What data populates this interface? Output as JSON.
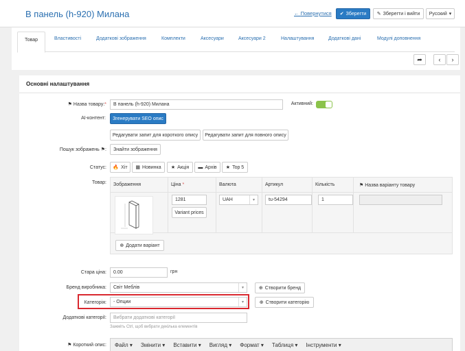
{
  "header": {
    "title": "В панель (h-920) Милана",
    "back_label": "Повернутися",
    "save_label": "Зберегти",
    "save_exit_label": "Зберегти і вийти",
    "language": "Русский"
  },
  "tabs": [
    {
      "label": "Товар",
      "active": true
    },
    {
      "label": "Властивості",
      "active": false
    },
    {
      "label": "Додаткові зображення",
      "active": false
    },
    {
      "label": "Комплекти",
      "active": false
    },
    {
      "label": "Аксесуари",
      "active": false
    },
    {
      "label": "Аксесуари 2",
      "active": false
    },
    {
      "label": "Налаштування",
      "active": false
    },
    {
      "label": "Додаткові дані",
      "active": false
    },
    {
      "label": "Модулі доповнення",
      "active": false
    }
  ],
  "section_title": "Основні налаштування",
  "form": {
    "name_label": "Назва товару:",
    "name_value": "В панель (h-920) Милана",
    "active_label": "Активний:",
    "active": true,
    "ai_label": "AI-контент:",
    "seo_button": "Згенерувати SEO опис",
    "edit_short_prompt": "Редагувати запит для короткого опису",
    "edit_full_prompt": "Редагувати запит для повного опису",
    "image_search_label": "Пошук зображень",
    "find_images_button": "Знайти зображення",
    "status_label": "Статус:",
    "status_buttons": [
      "Хіт",
      "Новинка",
      "Акція",
      "Архів",
      "Top 5"
    ],
    "product_label": "Товар:",
    "old_price_label": "Стара ціна:",
    "old_price_value": "0.00",
    "currency_suffix": "грн",
    "brand_label": "Бренд виробника:",
    "brand_value": "Світ Меблів",
    "create_brand_button": "Створити бренд",
    "category_label": "Категорія:",
    "category_value": "- Опции",
    "create_category_button": "Створити категорію",
    "extra_categories_label": "Додаткові категорії:",
    "extra_categories_placeholder": "Вибрати додаткові категорії",
    "extra_categories_hint": "Зажміть Ctrl, щоб вибрати декілька елементів",
    "short_desc_label": "Короткий опис:"
  },
  "variants": {
    "headers": [
      "Зображення",
      "Ціна",
      "Валюта",
      "Артикул",
      "Кількість",
      "Назва варіанту товару"
    ],
    "price": "1281",
    "currency": "UAH",
    "sku": "tu-54294",
    "quantity": "1",
    "variant_prices_button": "Variant prices",
    "add_variant_button": "Додати варіант"
  },
  "editor_menu": [
    "Файл",
    "Змінити",
    "Вставити",
    "Вигляд",
    "Формат",
    "Таблиця",
    "Інструменти"
  ]
}
